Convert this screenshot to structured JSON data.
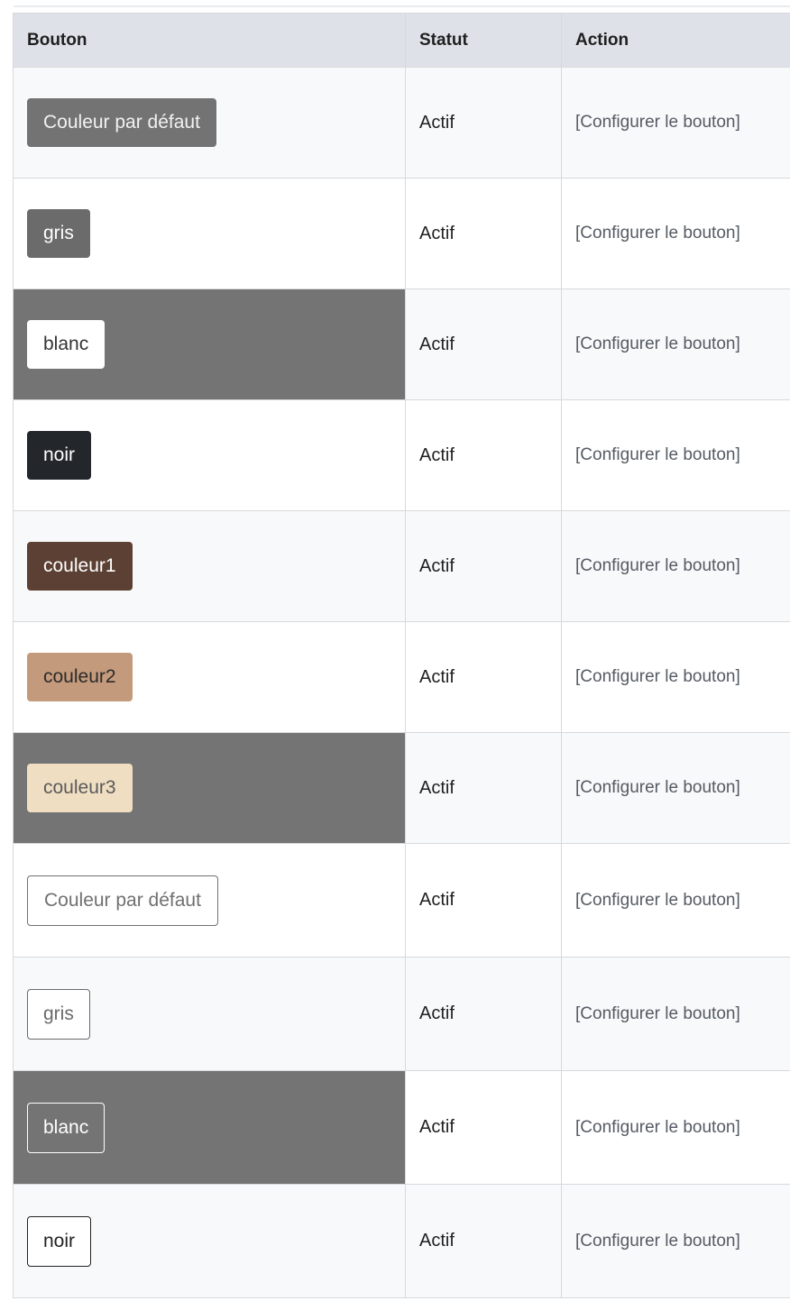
{
  "table": {
    "headers": {
      "button": "Bouton",
      "status": "Statut",
      "action": "Action"
    },
    "rows": [
      {
        "label": "Couleur par défaut",
        "style": "btn-default",
        "status": "Actif",
        "action": "[Configurer le bouton]",
        "dark_cell": false
      },
      {
        "label": "gris",
        "style": "btn-gris",
        "status": "Actif",
        "action": "[Configurer le bouton]",
        "dark_cell": false
      },
      {
        "label": "blanc",
        "style": "btn-blanc",
        "status": "Actif",
        "action": "[Configurer le bouton]",
        "dark_cell": true
      },
      {
        "label": "noir",
        "style": "btn-noir",
        "status": "Actif",
        "action": "[Configurer le bouton]",
        "dark_cell": false
      },
      {
        "label": "couleur1",
        "style": "btn-c1",
        "status": "Actif",
        "action": "[Configurer le bouton]",
        "dark_cell": false
      },
      {
        "label": "couleur2",
        "style": "btn-c2",
        "status": "Actif",
        "action": "[Configurer le bouton]",
        "dark_cell": false
      },
      {
        "label": "couleur3",
        "style": "btn-c3",
        "status": "Actif",
        "action": "[Configurer le bouton]",
        "dark_cell": true
      },
      {
        "label": "Couleur par défaut",
        "style": "btn-o-default",
        "status": "Actif",
        "action": "[Configurer le bouton]",
        "dark_cell": false
      },
      {
        "label": "gris",
        "style": "btn-o-gris",
        "status": "Actif",
        "action": "[Configurer le bouton]",
        "dark_cell": false
      },
      {
        "label": "blanc",
        "style": "btn-o-blanc",
        "status": "Actif",
        "action": "[Configurer le bouton]",
        "dark_cell": true
      },
      {
        "label": "noir",
        "style": "btn-o-noir",
        "status": "Actif",
        "action": "[Configurer le bouton]",
        "dark_cell": false
      }
    ]
  },
  "colors": {
    "header_bg": "#dee2e8",
    "dark_cell_bg": "#747474",
    "default": "#737373",
    "gris": "#6b6b6b",
    "blanc": "#ffffff",
    "noir": "#23262b",
    "couleur1": "#5c4033",
    "couleur2": "#c49a7c",
    "couleur3": "#f0dec3"
  }
}
